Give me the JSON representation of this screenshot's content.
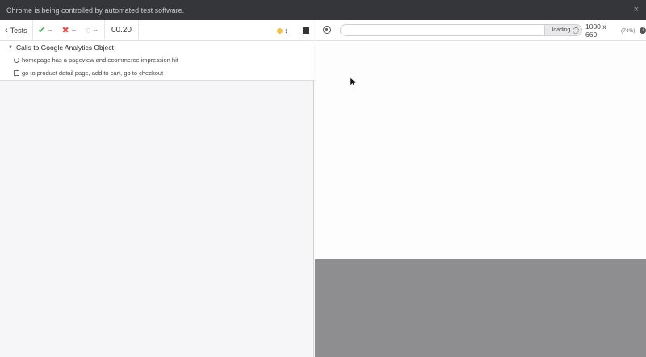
{
  "banner": {
    "text": "Chrome is being controlled by automated test software.",
    "close": "×"
  },
  "toolbar": {
    "tests_label": "Tests",
    "passed": "--",
    "failed": "--",
    "pending": "--",
    "duration": "00.20"
  },
  "suite": {
    "title": "Calls to Google Analytics Object",
    "tests": [
      "homepage has a pageview and ecommerce impression hit",
      "go to product detail page, add to cart, go to checkout"
    ]
  },
  "preview": {
    "url": "",
    "loading_label": "...loading",
    "viewport": "1000 x 660",
    "scale": "(74%)"
  }
}
